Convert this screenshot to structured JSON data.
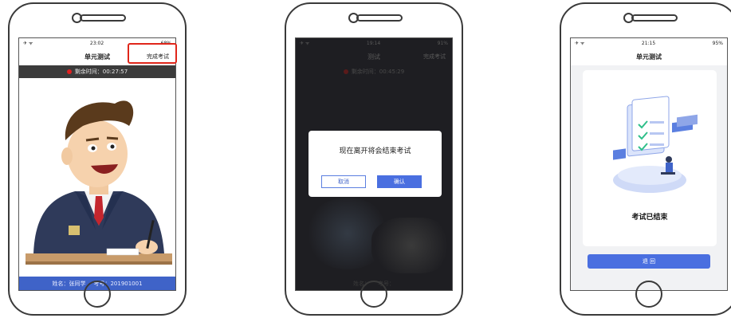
{
  "phone1": {
    "status": {
      "left": "✈ ᯤ",
      "time": "23:02",
      "battery": "68%"
    },
    "title": "单元测试",
    "finish_label": "完成考试",
    "timer": "剩余时间：00:27:57",
    "student_name": "姓名：张同学",
    "student_id": "考号：201901001"
  },
  "phone2": {
    "status": {
      "left": "✈ ᯤ",
      "time": "19:14",
      "battery": "91%"
    },
    "title": "测试",
    "finish_label": "完成考试",
    "timer": "剩余时间：00:45:29",
    "dialog_message": "现在离开将会结束考试",
    "cancel_label": "取消",
    "confirm_label": "确认",
    "student_name": "姓名：",
    "student_id": "考号："
  },
  "phone3": {
    "status": {
      "left": "✈ ᯤ",
      "time": "21:15",
      "battery": "95%"
    },
    "title": "单元测试",
    "finished_text": "考试已结束",
    "back_label": "退 回"
  },
  "colors": {
    "accent": "#4a6fe0",
    "highlight": "#e0261a",
    "timer_bg": "#3b3b3b"
  }
}
